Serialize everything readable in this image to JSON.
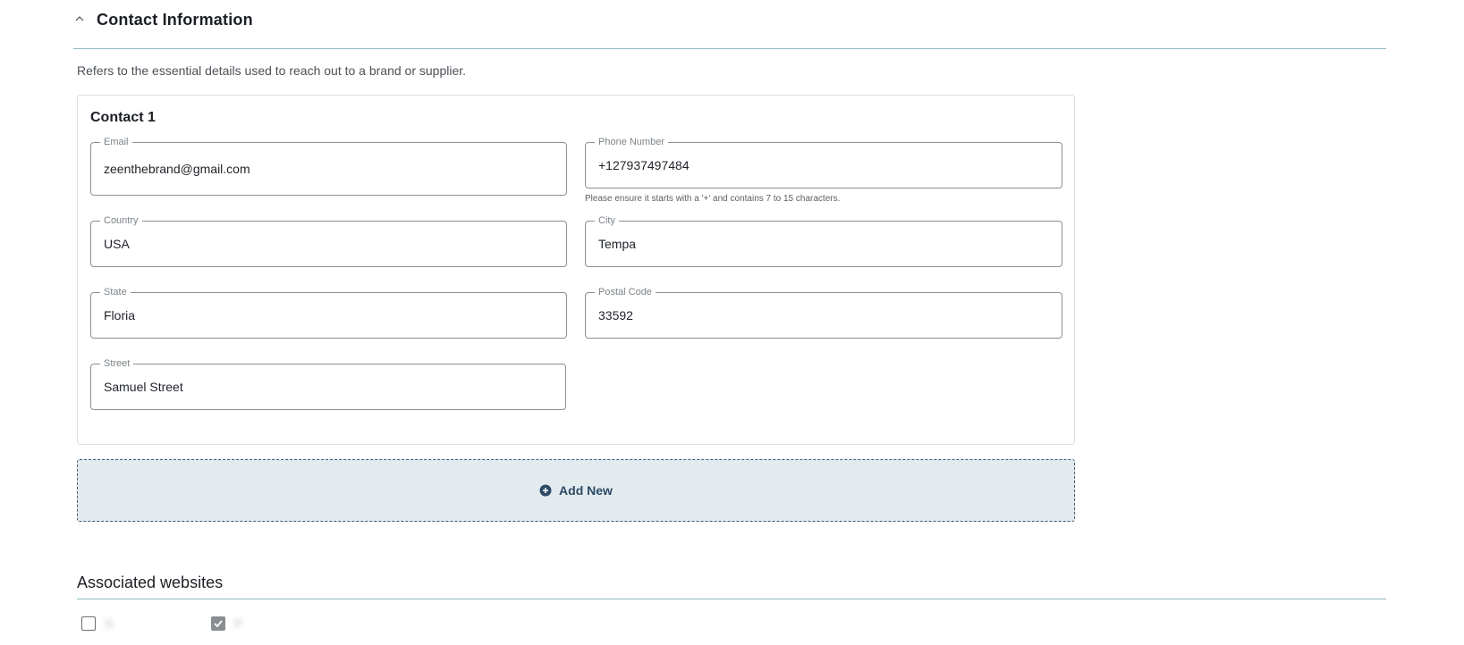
{
  "section": {
    "title": "Contact Information",
    "description": "Refers to the essential details used to reach out to a brand or supplier."
  },
  "contact": {
    "title": "Contact 1",
    "fields": {
      "email": {
        "label": "Email",
        "value": "zeenthebrand@gmail.com"
      },
      "phone": {
        "label": "Phone Number",
        "value": "+127937497484",
        "helper": "Please ensure it starts with a '+' and contains 7 to 15 characters."
      },
      "country": {
        "label": "Country",
        "value": "USA"
      },
      "city": {
        "label": "City",
        "value": "Tempa"
      },
      "state": {
        "label": "State",
        "value": "Floria"
      },
      "postal_code": {
        "label": "Postal Code",
        "value": "33592"
      },
      "street": {
        "label": "Street",
        "value": "Samuel Street"
      }
    }
  },
  "add_new": {
    "label": "Add New"
  },
  "websites": {
    "title": "Associated websites",
    "options": [
      {
        "label": "S",
        "checked": false
      },
      {
        "label": "P",
        "checked": true
      }
    ]
  },
  "colors": {
    "accent_line": "#8fb8bd",
    "add_new_bg": "#e3ebef",
    "add_new_text": "#2c4a66"
  }
}
